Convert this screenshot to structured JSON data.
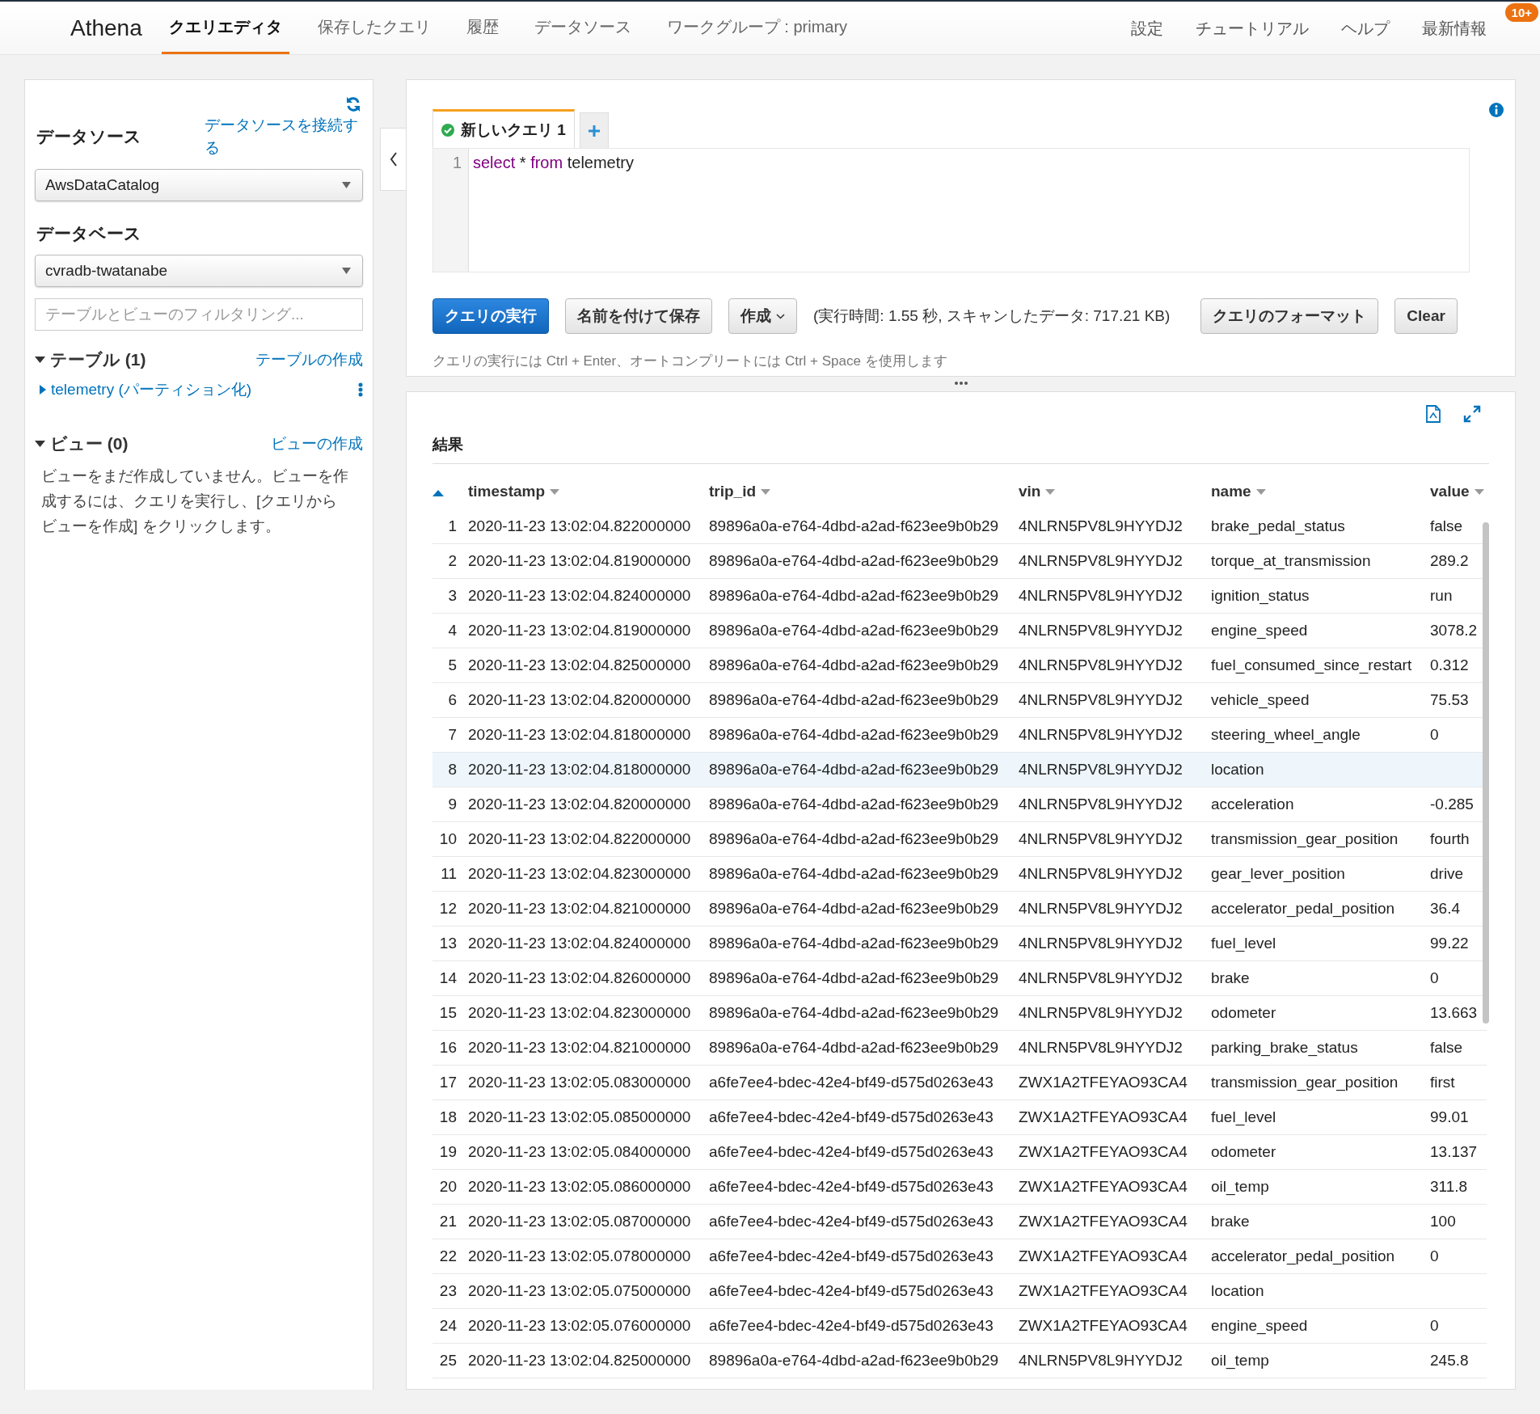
{
  "nav": {
    "brand": "Athena",
    "tabs": [
      {
        "label": "クエリエディタ",
        "selected": true
      },
      {
        "label": "保存したクエリ",
        "selected": false
      },
      {
        "label": "履歴",
        "selected": false
      },
      {
        "label": "データソース",
        "selected": false
      },
      {
        "label": "ワークグループ : primary",
        "selected": false
      }
    ],
    "links": [
      "設定",
      "チュートリアル",
      "ヘルプ",
      "最新情報"
    ],
    "badge": "10+"
  },
  "sidebar": {
    "datasource_title": "データソース",
    "connect_link": "データソースを接続する",
    "catalog": "AwsDataCatalog",
    "database_title": "データベース",
    "database": "cvradb-twatanabe",
    "filter": {
      "placeholder": "テーブルとビューのフィルタリング..."
    },
    "sections": [
      {
        "title": "テーブル (1)",
        "action": "テーブルの作成",
        "expanded": true,
        "items": [
          {
            "label": "telemetry (パーティション化)",
            "expanded": false
          }
        ]
      },
      {
        "title": "ビュー (0)",
        "action": "ビューの作成",
        "expanded": true,
        "empty_text": "ビューをまだ作成していません。ビューを作成するには、クエリを実行し、[クエリからビューを作成] をクリックします。"
      }
    ]
  },
  "editor": {
    "tab": {
      "label": "新しいクエリ 1",
      "succeeded": true
    },
    "line_number": "1",
    "code": [
      {
        "text": "select",
        "kind": "keyword"
      },
      {
        "text": " * ",
        "kind": "plain"
      },
      {
        "text": "from",
        "kind": "keyword"
      },
      {
        "text": " telemetry",
        "kind": "plain"
      }
    ],
    "run_button": "クエリの実行",
    "save_button": "名前を付けて保存",
    "create_button": "作成",
    "stats": "(実行時間: 1.55 秒, スキャンしたデータ: 717.21 KB)",
    "format_button": "クエリのフォーマット",
    "clear_button": "Clear",
    "hint": "クエリの実行には Ctrl + Enter、オートコンプリートには Ctrl + Space を使用します"
  },
  "results": {
    "title": "結果",
    "index_sorted": true,
    "columns": [
      "timestamp",
      "trip_id",
      "vin",
      "name",
      "value"
    ],
    "rows": [
      {
        "n": "1",
        "cells": [
          "2020-11-23 13:02:04.822000000",
          "89896a0a-e764-4dbd-a2ad-f623ee9b0b29",
          "4NLRN5PV8L9HYYDJ2",
          "brake_pedal_status",
          "false"
        ],
        "selected": false
      },
      {
        "n": "2",
        "cells": [
          "2020-11-23 13:02:04.819000000",
          "89896a0a-e764-4dbd-a2ad-f623ee9b0b29",
          "4NLRN5PV8L9HYYDJ2",
          "torque_at_transmission",
          "289.2"
        ],
        "selected": false
      },
      {
        "n": "3",
        "cells": [
          "2020-11-23 13:02:04.824000000",
          "89896a0a-e764-4dbd-a2ad-f623ee9b0b29",
          "4NLRN5PV8L9HYYDJ2",
          "ignition_status",
          "run"
        ],
        "selected": false
      },
      {
        "n": "4",
        "cells": [
          "2020-11-23 13:02:04.819000000",
          "89896a0a-e764-4dbd-a2ad-f623ee9b0b29",
          "4NLRN5PV8L9HYYDJ2",
          "engine_speed",
          "3078.2"
        ],
        "selected": false
      },
      {
        "n": "5",
        "cells": [
          "2020-11-23 13:02:04.825000000",
          "89896a0a-e764-4dbd-a2ad-f623ee9b0b29",
          "4NLRN5PV8L9HYYDJ2",
          "fuel_consumed_since_restart",
          "0.312"
        ],
        "selected": false
      },
      {
        "n": "6",
        "cells": [
          "2020-11-23 13:02:04.820000000",
          "89896a0a-e764-4dbd-a2ad-f623ee9b0b29",
          "4NLRN5PV8L9HYYDJ2",
          "vehicle_speed",
          "75.53"
        ],
        "selected": false
      },
      {
        "n": "7",
        "cells": [
          "2020-11-23 13:02:04.818000000",
          "89896a0a-e764-4dbd-a2ad-f623ee9b0b29",
          "4NLRN5PV8L9HYYDJ2",
          "steering_wheel_angle",
          "0"
        ],
        "selected": false
      },
      {
        "n": "8",
        "cells": [
          "2020-11-23 13:02:04.818000000",
          "89896a0a-e764-4dbd-a2ad-f623ee9b0b29",
          "4NLRN5PV8L9HYYDJ2",
          "location"
        ],
        "selected": true
      },
      {
        "n": "9",
        "cells": [
          "2020-11-23 13:02:04.820000000",
          "89896a0a-e764-4dbd-a2ad-f623ee9b0b29",
          "4NLRN5PV8L9HYYDJ2",
          "acceleration",
          "-0.285"
        ],
        "selected": false
      },
      {
        "n": "10",
        "cells": [
          "2020-11-23 13:02:04.822000000",
          "89896a0a-e764-4dbd-a2ad-f623ee9b0b29",
          "4NLRN5PV8L9HYYDJ2",
          "transmission_gear_position",
          "fourth"
        ],
        "selected": false
      },
      {
        "n": "11",
        "cells": [
          "2020-11-23 13:02:04.823000000",
          "89896a0a-e764-4dbd-a2ad-f623ee9b0b29",
          "4NLRN5PV8L9HYYDJ2",
          "gear_lever_position",
          "drive"
        ],
        "selected": false
      },
      {
        "n": "12",
        "cells": [
          "2020-11-23 13:02:04.821000000",
          "89896a0a-e764-4dbd-a2ad-f623ee9b0b29",
          "4NLRN5PV8L9HYYDJ2",
          "accelerator_pedal_position",
          "36.4"
        ],
        "selected": false
      },
      {
        "n": "13",
        "cells": [
          "2020-11-23 13:02:04.824000000",
          "89896a0a-e764-4dbd-a2ad-f623ee9b0b29",
          "4NLRN5PV8L9HYYDJ2",
          "fuel_level",
          "99.22"
        ],
        "selected": false
      },
      {
        "n": "14",
        "cells": [
          "2020-11-23 13:02:04.826000000",
          "89896a0a-e764-4dbd-a2ad-f623ee9b0b29",
          "4NLRN5PV8L9HYYDJ2",
          "brake",
          "0"
        ],
        "selected": false
      },
      {
        "n": "15",
        "cells": [
          "2020-11-23 13:02:04.823000000",
          "89896a0a-e764-4dbd-a2ad-f623ee9b0b29",
          "4NLRN5PV8L9HYYDJ2",
          "odometer",
          "13.663"
        ],
        "selected": false
      },
      {
        "n": "16",
        "cells": [
          "2020-11-23 13:02:04.821000000",
          "89896a0a-e764-4dbd-a2ad-f623ee9b0b29",
          "4NLRN5PV8L9HYYDJ2",
          "parking_brake_status",
          "false"
        ],
        "selected": false
      },
      {
        "n": "17",
        "cells": [
          "2020-11-23 13:02:05.083000000",
          "a6fe7ee4-bdec-42e4-bf49-d575d0263e43",
          "ZWX1A2TFEYAO93CA4",
          "transmission_gear_position",
          "first"
        ],
        "selected": false
      },
      {
        "n": "18",
        "cells": [
          "2020-11-23 13:02:05.085000000",
          "a6fe7ee4-bdec-42e4-bf49-d575d0263e43",
          "ZWX1A2TFEYAO93CA4",
          "fuel_level",
          "99.01"
        ],
        "selected": false
      },
      {
        "n": "19",
        "cells": [
          "2020-11-23 13:02:05.084000000",
          "a6fe7ee4-bdec-42e4-bf49-d575d0263e43",
          "ZWX1A2TFEYAO93CA4",
          "odometer",
          "13.137"
        ],
        "selected": false
      },
      {
        "n": "20",
        "cells": [
          "2020-11-23 13:02:05.086000000",
          "a6fe7ee4-bdec-42e4-bf49-d575d0263e43",
          "ZWX1A2TFEYAO93CA4",
          "oil_temp",
          "311.8"
        ],
        "selected": false
      },
      {
        "n": "21",
        "cells": [
          "2020-11-23 13:02:05.087000000",
          "a6fe7ee4-bdec-42e4-bf49-d575d0263e43",
          "ZWX1A2TFEYAO93CA4",
          "brake",
          "100"
        ],
        "selected": false
      },
      {
        "n": "22",
        "cells": [
          "2020-11-23 13:02:05.078000000",
          "a6fe7ee4-bdec-42e4-bf49-d575d0263e43",
          "ZWX1A2TFEYAO93CA4",
          "accelerator_pedal_position",
          "0"
        ],
        "selected": false
      },
      {
        "n": "23",
        "cells": [
          "2020-11-23 13:02:05.075000000",
          "a6fe7ee4-bdec-42e4-bf49-d575d0263e43",
          "ZWX1A2TFEYAO93CA4",
          "location"
        ],
        "selected": false
      },
      {
        "n": "24",
        "cells": [
          "2020-11-23 13:02:05.076000000",
          "a6fe7ee4-bdec-42e4-bf49-d575d0263e43",
          "ZWX1A2TFEYAO93CA4",
          "engine_speed",
          "0"
        ],
        "selected": false
      },
      {
        "n": "25",
        "cells": [
          "2020-11-23 13:02:04.825000000",
          "89896a0a-e764-4dbd-a2ad-f623ee9b0b29",
          "4NLRN5PV8L9HYYDJ2",
          "oil_temp",
          "245.8"
        ],
        "selected": false
      }
    ]
  }
}
